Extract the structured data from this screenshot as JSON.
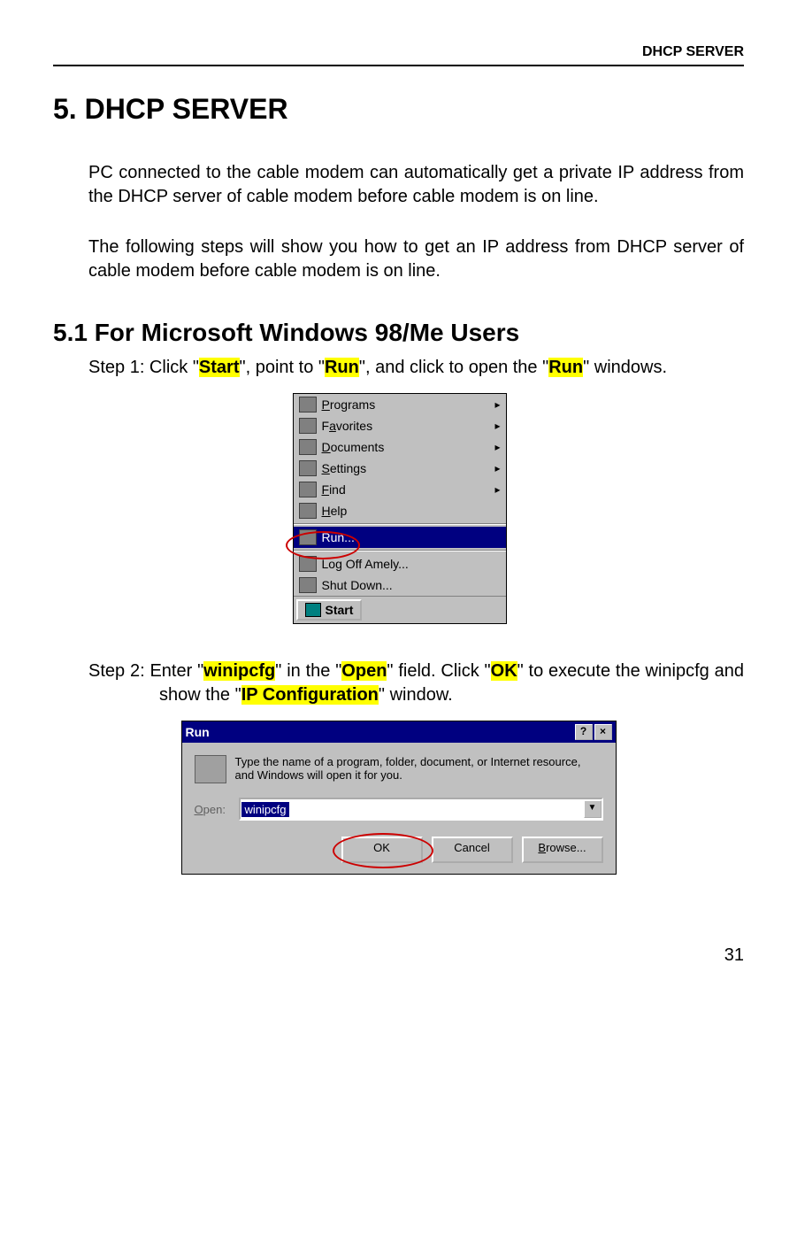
{
  "header": {
    "section": "DHCP SERVER"
  },
  "h1": "5. DHCP SERVER",
  "para1": "PC connected to the cable modem can automatically get a private IP address from the DHCP server of cable modem before cable modem is on line.",
  "para2": "The following steps will show you how to get an IP address from DHCP server of cable modem before cable modem is on line.",
  "h2": "5.1 For Microsoft Windows 98/Me Users",
  "step1": {
    "pre1": "Step 1: Click \"",
    "hl1": "Start",
    "mid1": "\", point to \"",
    "hl2": "Run",
    "mid2": "\", and click to open the \"",
    "hl3": "Run",
    "post": "\" windows."
  },
  "start_menu": {
    "items": [
      {
        "label": "Programs",
        "arrow": true
      },
      {
        "label": "Favorites",
        "arrow": true
      },
      {
        "label": "Documents",
        "arrow": true
      },
      {
        "label": "Settings",
        "arrow": true
      },
      {
        "label": "Find",
        "arrow": true
      },
      {
        "label": "Help",
        "arrow": false
      },
      {
        "label": "Run...",
        "arrow": false,
        "selected": true
      },
      {
        "label": "Log Off Amely...",
        "arrow": false
      },
      {
        "label": "Shut Down...",
        "arrow": false
      }
    ],
    "start_button": "Start"
  },
  "step2": {
    "pre1": "Step 2: Enter \"",
    "hl1": "winipcfg",
    "mid1": "\" in the \"",
    "hl2": "Open",
    "mid2": "\" field. Click \"",
    "hl3": "OK",
    "mid3": "\" to execute the winipcfg and show the \"",
    "hl4": "IP Configuration",
    "post": "\" window."
  },
  "run_dialog": {
    "title": "Run",
    "help_btn": "?",
    "close_btn": "×",
    "desc": "Type the name of a program, folder, document, or Internet resource, and Windows will open it for you.",
    "open_label": "Open:",
    "open_value": "winipcfg",
    "combo_arrow": "▼",
    "ok": "OK",
    "cancel": "Cancel",
    "browse": "Browse..."
  },
  "page_number": "31"
}
